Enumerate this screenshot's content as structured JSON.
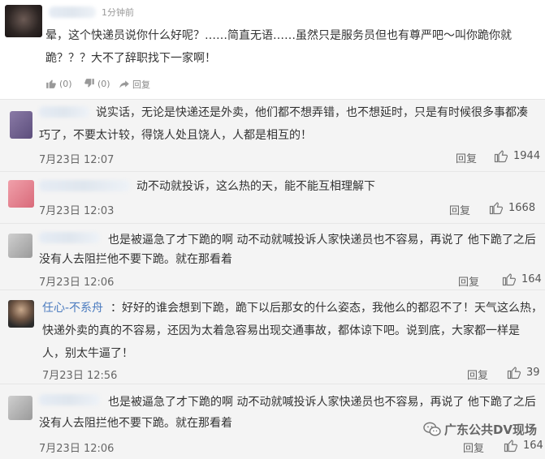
{
  "comments": [
    {
      "time": "1分钟前",
      "text_line1": "晕，这个快递员说你什么好呢？……简直无语……虽然只是服务员但也有尊严吧～叫你跪你就",
      "text_line2": "跪？？？大不了辞职找下一家啊！",
      "like": "(0)",
      "dislike": "(0)",
      "reply": "回复"
    },
    {
      "text_line1": "说实话，无论是快递还是外卖，他们都不想弄错，也不想延时，只是有时候很多事都凑",
      "text_line2": "巧了，不要太计较，得饶人处且饶人，人都是相互的！",
      "date": "7月23日 12:07",
      "reply": "回复",
      "likes": "1944"
    },
    {
      "text_line1": "动不动就投诉，这么热的天，能不能互相理解下",
      "date": "7月23日 12:03",
      "reply": "回复",
      "likes": "1668"
    },
    {
      "text_line1": "也是被逼急了才下跪的啊 动不动就喊投诉人家快递员也不容易，再说了 他下跪了之后",
      "text_line2": "没有人去阻拦他不要下跪。就在那看着",
      "date": "7月23日 12:06",
      "reply": "回复",
      "likes": "164"
    },
    {
      "username": "任心-不系舟",
      "text_line1": "：好好的谁会想到下跪，跪下以后那女的什么姿态，我他么的都忍不了！天气这么热，",
      "text_line2": "快递外卖的真的不容易，还因为太着急容易出现交通事故，都体谅下吧。说到底，大家都一样是",
      "text_line3": "人，别太牛逼了！",
      "date": "7月23日 12:56",
      "reply": "回复",
      "likes": "39"
    },
    {
      "text_line1": "也是被逼急了才下跪的啊 动不动就喊投诉人家快递员也不容易，再说了 他下跪了之后",
      "text_line2": "没有人去阻拦他不要下跪。就在那看着",
      "date": "7月23日 12:06",
      "reply": "回复",
      "likes": "164"
    }
  ],
  "watermark": "广东公共DV现场",
  "icons": {
    "thumb_up": "thumb-up-icon",
    "share": "share-icon",
    "wechat": "wechat-icon"
  }
}
